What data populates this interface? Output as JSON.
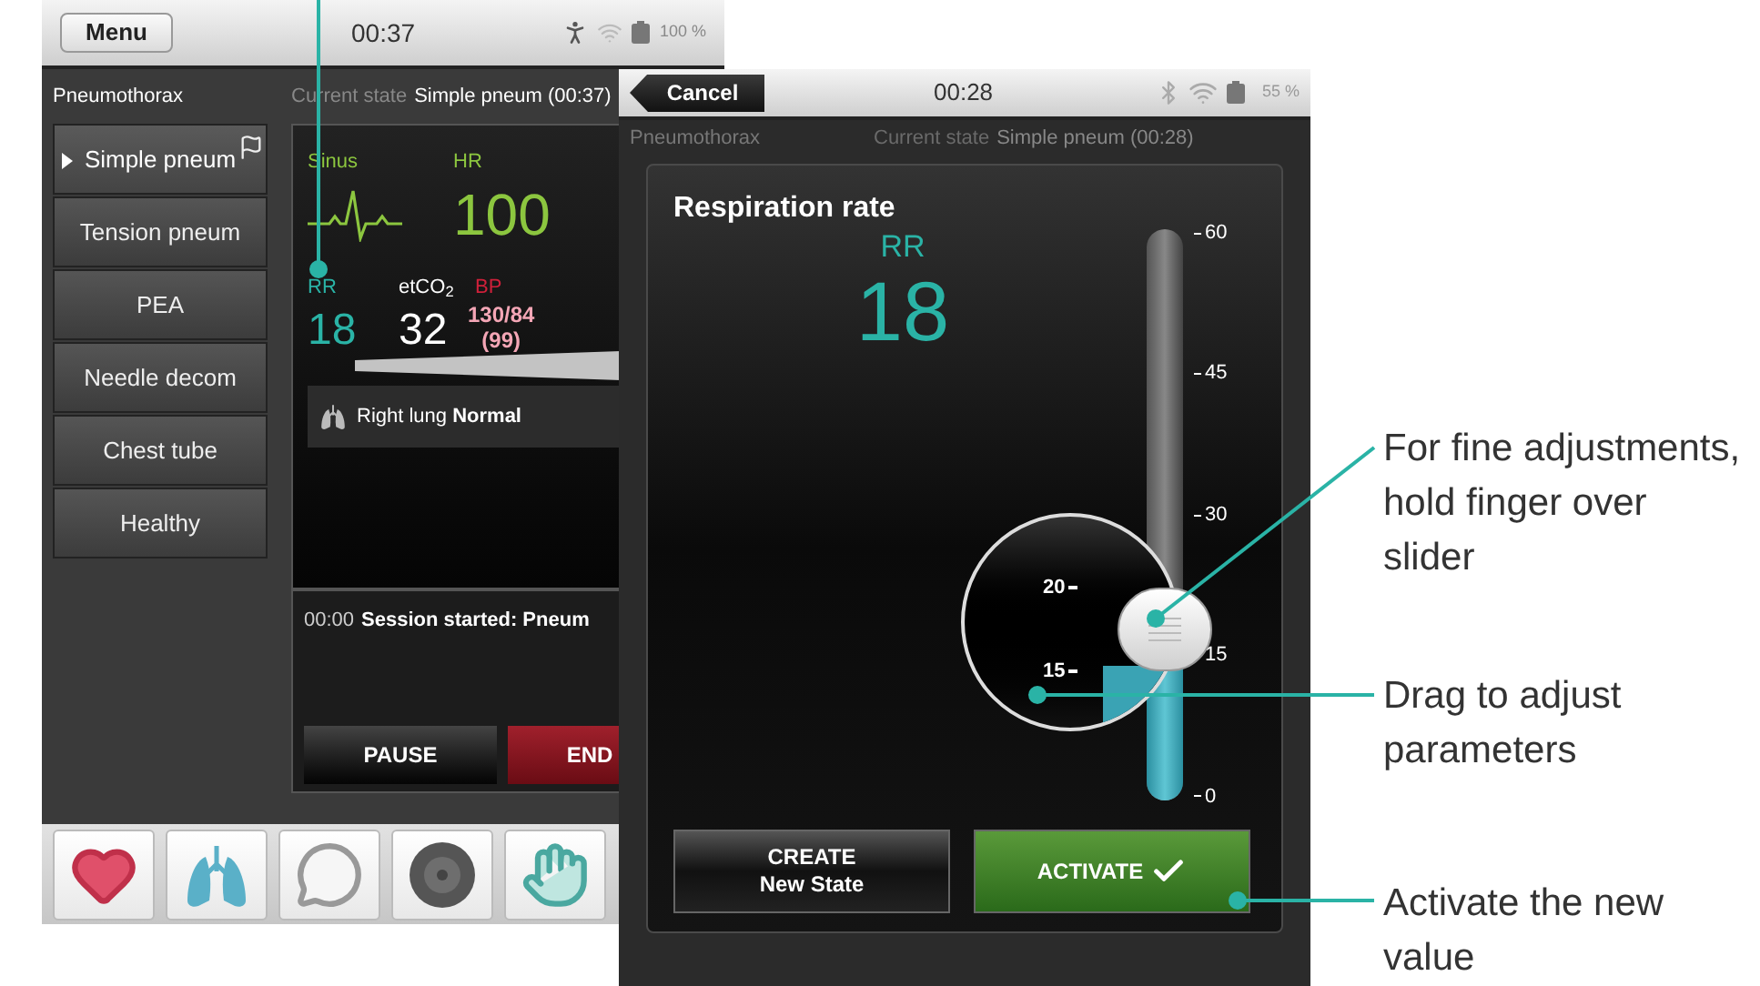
{
  "monitor_screen": {
    "header": {
      "menu_button": "Menu",
      "time": "00:37",
      "battery": "100 %"
    },
    "scenario": "Pneumothorax",
    "current_state": {
      "label": "Current state",
      "value": "Simple pneum (00:37)"
    },
    "states": [
      {
        "label": "Simple pneum",
        "selected": true
      },
      {
        "label": "Tension pneum",
        "selected": false
      },
      {
        "label": "PEA",
        "selected": false
      },
      {
        "label": "Needle decom",
        "selected": false
      },
      {
        "label": "Chest tube",
        "selected": false
      },
      {
        "label": "Healthy",
        "selected": false
      }
    ],
    "vitals": {
      "rhythm": "Sinus",
      "hr_label": "HR",
      "hr_value": "100",
      "rr_label": "RR",
      "rr_value": "18",
      "etco2_label": "etCO$_{2}$",
      "etco2_value": "32",
      "bp_label": "BP",
      "bp_value": [
        "130/84",
        "(99)"
      ]
    },
    "lung_status": "Right lung **Normal**",
    "log": [
      {
        "time": "00:00",
        "text": "Session started: Pneum"
      }
    ],
    "buttons": [
      {
        "label": "PAUSE",
        "kind": "pause"
      },
      {
        "label": "END",
        "kind": "end"
      }
    ]
  },
  "edit_screen": {
    "header": {
      "cancel_button": "Cancel",
      "time": "00:28",
      "battery": "55 %"
    },
    "scenario": "Pneumothorax",
    "current_state": {
      "label": "Current state",
      "value": "Simple pneum (00:28)"
    },
    "dialog": {
      "title": "Respiration rate",
      "parameter": "RR",
      "value": "18",
      "slider": {
        "level": 0.3,
        "ticks": [
          "60",
          "45",
          "30",
          "15",
          "0"
        ]
      },
      "magnifier_ticks": [
        "20",
        "15"
      ],
      "buttons": [
        {
          "lines": [
            "CREATE",
            "New State"
          ],
          "kind": "create"
        },
        {
          "lines": [
            "ACTIVATE"
          ],
          "kind": "activate"
        }
      ]
    }
  },
  "callouts": [
    "For fine adjustments, hold finger over slider",
    "Drag to adjust parameters",
    "Activate the new value"
  ]
}
